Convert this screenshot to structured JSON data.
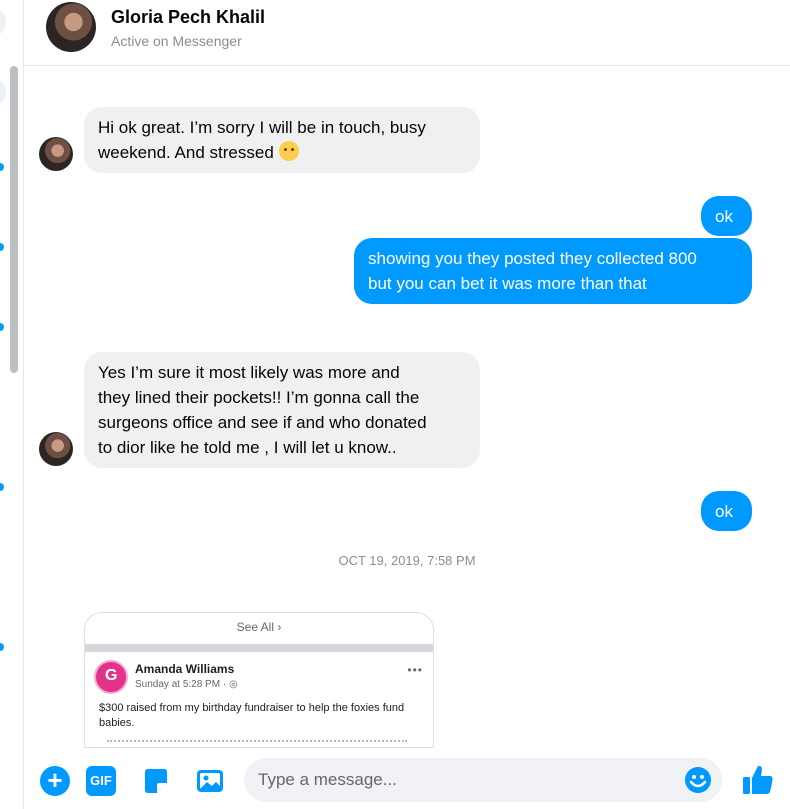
{
  "header": {
    "contact_name": "Gloria Pech Khalil",
    "status": "Active on Messenger"
  },
  "messages": [
    {
      "direction": "in",
      "lines": [
        "Hi ok great. I’m sorry I will be in touch, busy",
        "weekend. And stressed"
      ],
      "emoji": "crying-face"
    },
    {
      "direction": "out",
      "lines": [
        "ok"
      ]
    },
    {
      "direction": "out",
      "lines": [
        "showing you they posted they collected 800",
        "but you can bet it was more than that"
      ]
    },
    {
      "direction": "in",
      "lines": [
        "Yes I’m sure it most likely was more and",
        "they lined their pockets!! I’m gonna call the",
        "surgeons office and see if and who donated",
        "to dior like he told me , I will let u know.."
      ]
    },
    {
      "direction": "out",
      "lines": [
        "ok"
      ]
    }
  ],
  "timestamp": "OCT 19, 2019, 7:58 PM",
  "shared_post": {
    "see_all": "See All",
    "author": "Amanda Williams",
    "time": "Sunday at 5:28 PM ·",
    "text": "$300 raised from my birthday fundraiser to help the foxies fund babies."
  },
  "composer": {
    "gif_label": "GIF",
    "placeholder": "Type a message..."
  },
  "colors": {
    "accent": "#0099ff",
    "incoming_bubble": "#f0f0f0"
  }
}
